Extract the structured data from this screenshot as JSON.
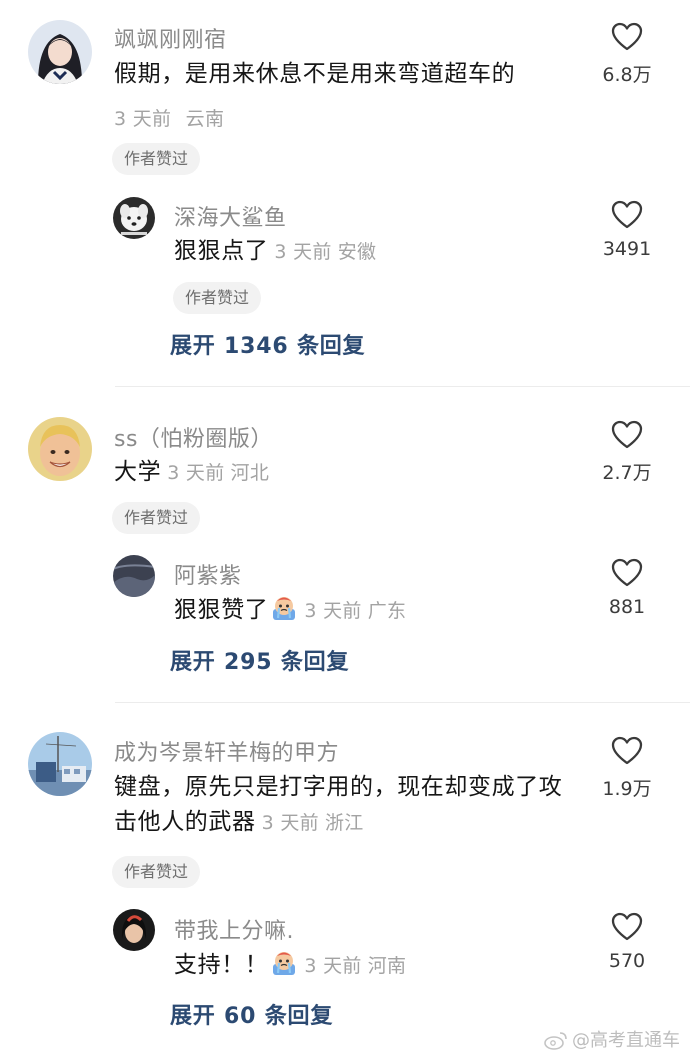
{
  "comments": [
    {
      "user": "飒飒刚刚宿",
      "text": "假期，是用来休息不是用来弯道超车的",
      "time": "3 天前",
      "location": "云南",
      "badge": "作者赞过",
      "likes": "6.8万",
      "avatar_icon": "girl-portrait-avatar",
      "reply": {
        "user": "深海大鲨鱼",
        "text": "狠狠点了",
        "time": "3 天前",
        "location": "安徽",
        "badge": "作者赞过",
        "likes": "3491",
        "avatar_icon": "white-dog-avatar"
      },
      "expand_label": "展开 1346 条回复"
    },
    {
      "user": "ss（怕粉圈版）",
      "text": "大学",
      "time": "3 天前",
      "location": "河北",
      "badge": "作者赞过",
      "likes": "2.7万",
      "avatar_icon": "smiling-boy-avatar",
      "reply": {
        "user": "阿紫紫",
        "text": "狠狠赞了",
        "time": "3 天前",
        "location": "广东",
        "likes": "881",
        "avatar_icon": "dark-abstract-avatar",
        "emoji": "crying-emoji"
      },
      "expand_label": "展开 295 条回复"
    },
    {
      "user": "成为岑景轩羊梅的甲方",
      "text_line1": "键盘，原先只是打字用的，现在却变成了攻",
      "text_line2": "击他人的武器",
      "time": "3 天前",
      "location": "浙江",
      "badge": "作者赞过",
      "likes": "1.9万",
      "avatar_icon": "anime-scenery-avatar",
      "reply": {
        "user": "带我上分嘛.",
        "text": "支持！！",
        "time": "3 天前",
        "location": "河南",
        "likes": "570",
        "avatar_icon": "dark-girl-avatar",
        "emoji": "crying-emoji"
      },
      "expand_label": "展开 60 条回复"
    }
  ],
  "watermark": "@高考直通车",
  "colors": {
    "expand_link": "#2c4a72",
    "meta": "#a3a3a3",
    "name": "#8a8a8a",
    "badge_bg": "#f2f2f2"
  }
}
